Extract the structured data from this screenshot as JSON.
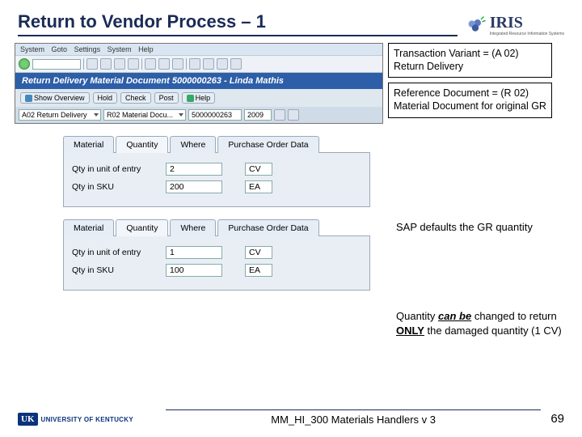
{
  "header": {
    "title": "Return to Vendor Process – 1",
    "logo_text": "IRIS",
    "logo_sub": "Integrated Resource Information Systems"
  },
  "sap": {
    "menu": {
      "i1": "System",
      "i2": "Goto",
      "i3": "Settings",
      "i4": "System",
      "i5": "Help"
    },
    "bluebar": "Return Delivery Material Document 5000000263 - Linda Mathis",
    "appbar": {
      "b1": "Show Overview",
      "b2": "Hold",
      "b3": "Check",
      "b4": "Post",
      "b5": "Help"
    },
    "filter": {
      "f1": "A02 Return Delivery",
      "f2": "R02 Material Docu...",
      "f3": "5000000263",
      "f4": "2009"
    }
  },
  "callouts": {
    "c1a": "Transaction Variant = (A 02)",
    "c1b": "Return Delivery",
    "c2a": "Reference Document = (R 02)",
    "c2b": "Material Document for original GR"
  },
  "panel": {
    "tabs": {
      "t1": "Material",
      "t2": "Quantity",
      "t3": "Where",
      "t4": "Purchase Order Data"
    },
    "l1": "Qty in unit of entry",
    "l2": "Qty in SKU",
    "p1": {
      "qty": "2",
      "unit1": "CV",
      "sku": "200",
      "unit2": "EA"
    },
    "p2": {
      "qty": "1",
      "unit1": "CV",
      "sku": "100",
      "unit2": "EA"
    }
  },
  "notes": {
    "n1": "SAP defaults the GR quantity",
    "n2_pre": "Quantity ",
    "n2_canbe": "can be",
    "n2_mid": " changed to return ",
    "n2_only": "ONLY",
    "n2_post": " the damaged quantity (1 CV)"
  },
  "footer": {
    "badge": "UK",
    "uni": "UNIVERSITY OF KENTUCKY",
    "center": "MM_HI_300 Materials Handlers v 3",
    "page": "69"
  }
}
